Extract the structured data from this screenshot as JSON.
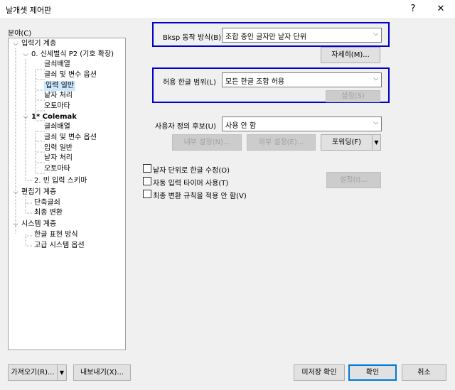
{
  "window": {
    "title": "날개셋 제어판",
    "help_glyph": "?",
    "close_glyph": "✕"
  },
  "nav": {
    "label": "분야(C)",
    "tree": [
      {
        "label": "입력기 계층",
        "twisty": "⌵"
      },
      {
        "label": "0. 신세벌식 P2 (기호 확장)",
        "twisty": "⌵"
      },
      {
        "label": "글쇠배열"
      },
      {
        "label": "글쇠 및 변수 옵션"
      },
      {
        "label": "입력 일반"
      },
      {
        "label": "낱자 처리"
      },
      {
        "label": "오토마타"
      },
      {
        "label": "1* Colemak",
        "twisty": "⌵"
      },
      {
        "label": "글쇠배열"
      },
      {
        "label": "글쇠 및 변수 옵션"
      },
      {
        "label": "입력 일반"
      },
      {
        "label": "낱자 처리"
      },
      {
        "label": "오토마타"
      },
      {
        "label": "2. 빈 입력 스키마"
      },
      {
        "label": "편집기 계층",
        "twisty": "⌵"
      },
      {
        "label": "단축글쇠"
      },
      {
        "label": "최종 변환"
      },
      {
        "label": "시스템 계층",
        "twisty": "⌵"
      },
      {
        "label": "한글 표현 방식"
      },
      {
        "label": "고급 시스템 옵션"
      }
    ]
  },
  "settings": {
    "bksp_label": "Bksp 동작 방식(B)",
    "bksp_value": "조합 중인 글자만 낱자 단위",
    "detail_button": "자세히(M)...",
    "range_label": "허용 한글 범위(L)",
    "range_value": "모든 한글 조합 허용",
    "range_setting_button": "설정(S)",
    "candidate_label": "사용자 정의 후보(U)",
    "candidate_value": "사용 안 함",
    "internal_button": "내부 설정(N)...",
    "external_button": "외부 설정(E)...",
    "forward_button": "포워딩(F)",
    "forward_arrow": "▼",
    "options": [
      {
        "label": "낱자 단위로 한글 수정(O)",
        "checked": false
      },
      {
        "label": "자동 입력 타이머 사용(T)",
        "checked": false
      },
      {
        "label": "최종 변환 규칙을 적용 안 함(V)",
        "checked": false
      }
    ],
    "timer_setting_button": "설정(I)...",
    "combo_arrow": "⌵"
  },
  "footer": {
    "import_button": "가져오기(R)...",
    "import_arrow": "▼",
    "export_button": "내보내기(X)...",
    "unsaved_button": "미저장 확인",
    "ok_button": "확인",
    "cancel_button": "취소"
  },
  "colors": {
    "highlight_border": "#0000c8",
    "selection": "#cce8ff",
    "primary_border": "#0078d7"
  }
}
